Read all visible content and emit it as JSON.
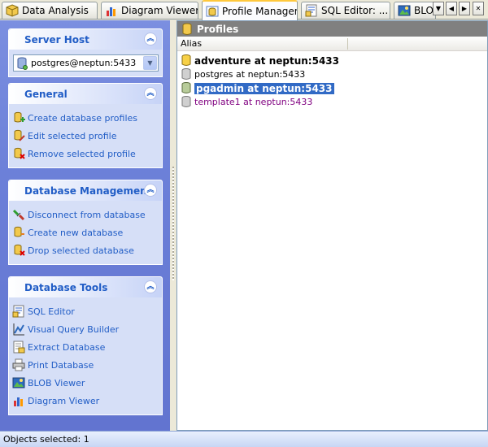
{
  "tabs": [
    {
      "label": "Data Analysis",
      "icon": "cube-icon"
    },
    {
      "label": "Diagram Viewer",
      "icon": "bar-chart-icon"
    },
    {
      "label": "Profile Manager",
      "icon": "profile-manager-icon"
    },
    {
      "label": "SQL Editor: ...",
      "icon": "sql-editor-icon"
    },
    {
      "label": "BLO",
      "icon": "blob-viewer-icon"
    }
  ],
  "tab_nav": {
    "dropdown": "▼",
    "prev": "◀",
    "next": "▶",
    "close": "✕"
  },
  "server_host": {
    "title": "Server Host",
    "selected": "postgres@neptun:5433"
  },
  "general": {
    "title": "General",
    "items": [
      {
        "label": "Create database profiles",
        "icon": "create-profile-icon"
      },
      {
        "label": "Edit selected profile",
        "icon": "edit-profile-icon"
      },
      {
        "label": "Remove selected profile",
        "icon": "remove-profile-icon"
      }
    ]
  },
  "db_management": {
    "title": "Database Management",
    "items": [
      {
        "label": "Disconnect from database",
        "icon": "disconnect-icon"
      },
      {
        "label": "Create new database",
        "icon": "create-database-icon"
      },
      {
        "label": "Drop selected database",
        "icon": "drop-database-icon"
      }
    ]
  },
  "db_tools": {
    "title": "Database Tools",
    "items": [
      {
        "label": "SQL Editor",
        "icon": "sql-editor-icon"
      },
      {
        "label": "Visual Query Builder",
        "icon": "query-builder-icon"
      },
      {
        "label": "Extract Database",
        "icon": "extract-database-icon"
      },
      {
        "label": "Print Database",
        "icon": "printer-icon"
      },
      {
        "label": "BLOB Viewer",
        "icon": "blob-viewer-icon"
      },
      {
        "label": "Diagram Viewer",
        "icon": "bar-chart-icon"
      }
    ]
  },
  "profiles": {
    "title": "Profiles",
    "column_alias": "Alias",
    "rows": [
      {
        "label": "adventure at neptun:5433",
        "state": "connected"
      },
      {
        "label": "postgres at neptun:5433",
        "state": "normal"
      },
      {
        "label": "pgadmin at neptun:5433",
        "state": "selected"
      },
      {
        "label": "template1 at neptun:5433",
        "state": "template"
      }
    ]
  },
  "status": {
    "text": "Objects selected: 1"
  },
  "colors": {
    "accent": "#215DC6",
    "pane": "#6B7FD8",
    "selection": "#316AC5",
    "template_text": "#800080"
  }
}
